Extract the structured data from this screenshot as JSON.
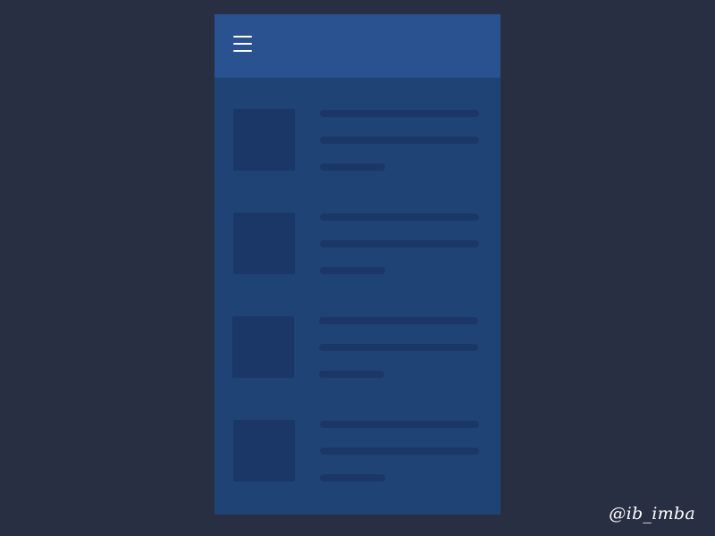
{
  "colors": {
    "backdrop": "#292f43",
    "phone_body": "#1f4375",
    "header": "#2a5190",
    "thumb_placeholder": "#1b3768",
    "line_placeholder": "#1b3768",
    "menu_icon": "#ffffff",
    "watermark_text": "#ffffff"
  },
  "header": {
    "menu_icon": "hamburger-menu-icon"
  },
  "list": {
    "items": [
      {
        "kind": "skeleton-placeholder"
      },
      {
        "kind": "skeleton-placeholder"
      },
      {
        "kind": "skeleton-placeholder"
      },
      {
        "kind": "skeleton-placeholder"
      }
    ]
  },
  "watermark": {
    "text": "@ib_imba"
  }
}
